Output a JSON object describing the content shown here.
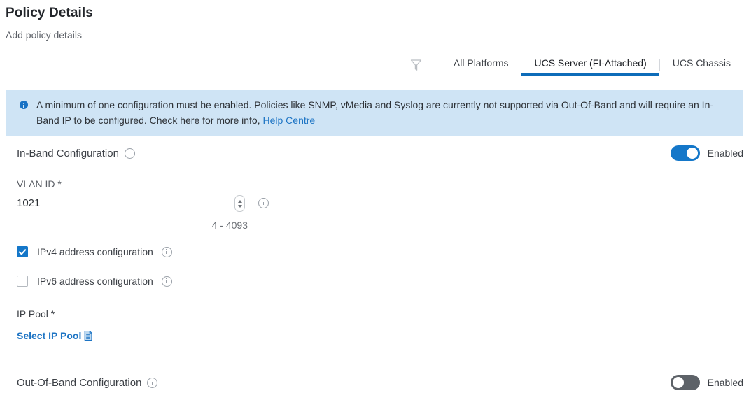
{
  "header": {
    "title": "Policy Details",
    "subtitle": "Add policy details"
  },
  "platform_bar": {
    "filter_icon": "filter-funnel-icon",
    "tabs": [
      {
        "label": "All Platforms",
        "selected": false
      },
      {
        "label": "UCS Server (FI-Attached)",
        "selected": true
      },
      {
        "label": "UCS Chassis",
        "selected": false
      }
    ]
  },
  "info_banner": {
    "icon": "info-circle-icon",
    "text_before_link": "A minimum of one configuration must be enabled. Policies like SNMP, vMedia and Syslog are currently not supported via Out-Of-Band and will require an In-Band IP to be configured. Check here for more info, ",
    "link_label": "Help Centre"
  },
  "in_band": {
    "label": "In-Band Configuration",
    "info_icon": "info-icon",
    "toggle": {
      "state": "on",
      "label": "Enabled"
    },
    "vlan": {
      "label": "VLAN ID *",
      "value": "1021",
      "placeholder": "VLAN ID",
      "hint": "4 - 4093",
      "stepper_icon": "stepper-up-down-icon",
      "info_icon": "info-icon"
    },
    "ipv4": {
      "label": "IPv4 address configuration",
      "checked": true,
      "info_icon": "info-icon"
    },
    "ipv6": {
      "label": "IPv6 address configuration",
      "checked": false,
      "info_icon": "info-icon"
    },
    "ip_pool": {
      "label": "IP Pool *",
      "select_label": "Select IP Pool",
      "select_icon": "document-list-icon"
    }
  },
  "out_of_band": {
    "label": "Out-Of-Band Configuration",
    "info_icon": "info-icon",
    "toggle": {
      "state": "off",
      "label": "Enabled"
    }
  },
  "colors": {
    "accent_blue": "#1477c9",
    "link_blue": "#1d74c4",
    "tab_underline": "#0d6cb9",
    "banner_bg": "#cfe4f5",
    "toggle_off": "#5d6268"
  }
}
